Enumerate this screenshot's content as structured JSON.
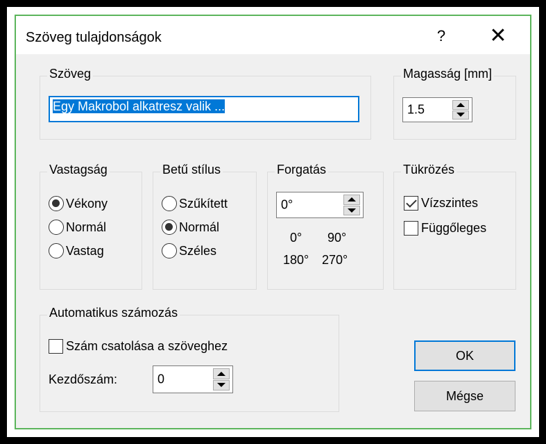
{
  "dialog": {
    "title": "Szöveg tulajdonságok",
    "help_label": "?",
    "close_label": "✕"
  },
  "text_group": {
    "label": "Szöveg",
    "value": "Egy Makrobol alkatresz valik ..."
  },
  "height_group": {
    "label": "Magasság [mm]",
    "value": "1.5"
  },
  "thickness_group": {
    "label": "Vastagság",
    "options": [
      "Vékony",
      "Normál",
      "Vastag"
    ],
    "selected": "Vékony"
  },
  "font_style_group": {
    "label": "Betű stílus",
    "options": [
      "Szűkített",
      "Normál",
      "Széles"
    ],
    "selected": "Normál"
  },
  "rotation_group": {
    "label": "Forgatás",
    "value": "0°",
    "presets": [
      "0°",
      "90°",
      "180°",
      "270°"
    ]
  },
  "mirror_group": {
    "label": "Tükrözés",
    "horizontal_label": "Vízszintes",
    "horizontal_checked": true,
    "vertical_label": "Függőleges",
    "vertical_checked": false
  },
  "numbering_group": {
    "label": "Automatikus számozás",
    "attach_label": "Szám csatolása a szöveghez",
    "attach_checked": false,
    "start_label": "Kezdőszám:",
    "start_value": "0"
  },
  "buttons": {
    "ok_label": "OK",
    "cancel_label": "Mégse"
  }
}
